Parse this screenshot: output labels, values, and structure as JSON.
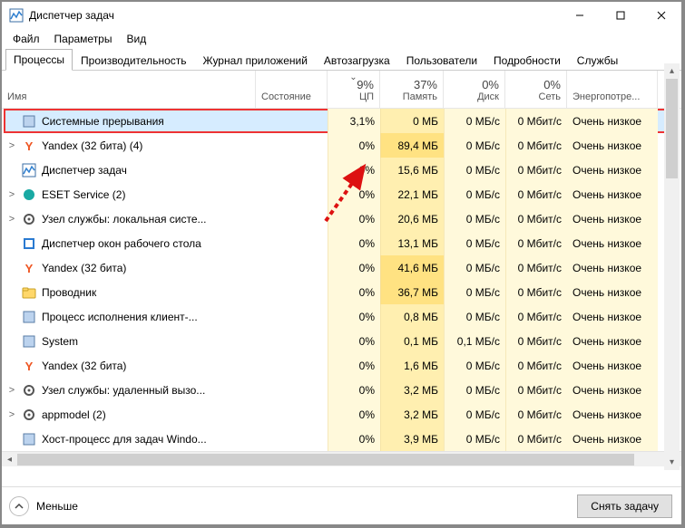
{
  "window": {
    "title": "Диспетчер задач"
  },
  "menu": {
    "file": "Файл",
    "options": "Параметры",
    "view": "Вид"
  },
  "tabs": {
    "processes": "Процессы",
    "performance": "Производительность",
    "apphistory": "Журнал приложений",
    "startup": "Автозагрузка",
    "users": "Пользователи",
    "details": "Подробности",
    "services": "Службы"
  },
  "columns": {
    "name": "Имя",
    "status": "Состояние",
    "cpu_pct": "9%",
    "cpu_label": "ЦП",
    "mem_pct": "37%",
    "mem_label": "Память",
    "disk_pct": "0%",
    "disk_label": "Диск",
    "net_pct": "0%",
    "net_label": "Сеть",
    "power_label": "Энергопотре..."
  },
  "rows": [
    {
      "expand": false,
      "icon": "system",
      "name": "Системные прерывания",
      "cpu": "3,1%",
      "mem": "0 МБ",
      "disk": "0 МБ/с",
      "net": "0 Мбит/с",
      "power": "Очень низкое",
      "selected": true
    },
    {
      "expand": true,
      "icon": "yandex",
      "name": "Yandex (32 бита) (4)",
      "cpu": "0%",
      "mem": "89,4 МБ",
      "mem_high": true,
      "disk": "0 МБ/с",
      "net": "0 Мбит/с",
      "power": "Очень низкое"
    },
    {
      "expand": false,
      "icon": "tm",
      "name": "Диспетчер задач",
      "cpu": "0%",
      "mem": "15,6 МБ",
      "disk": "0 МБ/с",
      "net": "0 Мбит/с",
      "power": "Очень низкое"
    },
    {
      "expand": true,
      "icon": "eset",
      "name": "ESET Service (2)",
      "cpu": "0%",
      "mem": "22,1 МБ",
      "disk": "0 МБ/с",
      "net": "0 Мбит/с",
      "power": "Очень низкое"
    },
    {
      "expand": true,
      "icon": "svc",
      "name": "Узел службы: локальная систе...",
      "cpu": "0%",
      "mem": "20,6 МБ",
      "disk": "0 МБ/с",
      "net": "0 Мбит/с",
      "power": "Очень низкое"
    },
    {
      "expand": false,
      "icon": "dwm",
      "name": "Диспетчер окон рабочего стола",
      "cpu": "0%",
      "mem": "13,1 МБ",
      "disk": "0 МБ/с",
      "net": "0 Мбит/с",
      "power": "Очень низкое"
    },
    {
      "expand": false,
      "icon": "yandex",
      "name": "Yandex (32 бита)",
      "cpu": "0%",
      "mem": "41,6 МБ",
      "mem_high": true,
      "disk": "0 МБ/с",
      "net": "0 Мбит/с",
      "power": "Очень низкое"
    },
    {
      "expand": false,
      "icon": "explorer",
      "name": "Проводник",
      "cpu": "0%",
      "mem": "36,7 МБ",
      "mem_high": true,
      "disk": "0 МБ/с",
      "net": "0 Мбит/с",
      "power": "Очень низкое"
    },
    {
      "expand": false,
      "icon": "proc",
      "name": "Процесс исполнения клиент-...",
      "cpu": "0%",
      "mem": "0,8 МБ",
      "disk": "0 МБ/с",
      "net": "0 Мбит/с",
      "power": "Очень низкое"
    },
    {
      "expand": false,
      "icon": "proc",
      "name": "System",
      "cpu": "0%",
      "mem": "0,1 МБ",
      "disk": "0,1 МБ/с",
      "net": "0 Мбит/с",
      "power": "Очень низкое"
    },
    {
      "expand": false,
      "icon": "yandex",
      "name": "Yandex (32 бита)",
      "cpu": "0%",
      "mem": "1,6 МБ",
      "disk": "0 МБ/с",
      "net": "0 Мбит/с",
      "power": "Очень низкое"
    },
    {
      "expand": true,
      "icon": "svc",
      "name": "Узел службы: удаленный вызо...",
      "cpu": "0%",
      "mem": "3,2 МБ",
      "disk": "0 МБ/с",
      "net": "0 Мбит/с",
      "power": "Очень низкое"
    },
    {
      "expand": true,
      "icon": "svc",
      "name": "appmodel (2)",
      "cpu": "0%",
      "mem": "3,2 МБ",
      "disk": "0 МБ/с",
      "net": "0 Мбит/с",
      "power": "Очень низкое"
    },
    {
      "expand": false,
      "icon": "proc",
      "name": "Хост-процесс для задач Windo...",
      "cpu": "0%",
      "mem": "3,9 МБ",
      "disk": "0 МБ/с",
      "net": "0 Мбит/с",
      "power": "Очень низкое"
    }
  ],
  "footer": {
    "fewer": "Меньше",
    "endtask": "Снять задачу"
  }
}
